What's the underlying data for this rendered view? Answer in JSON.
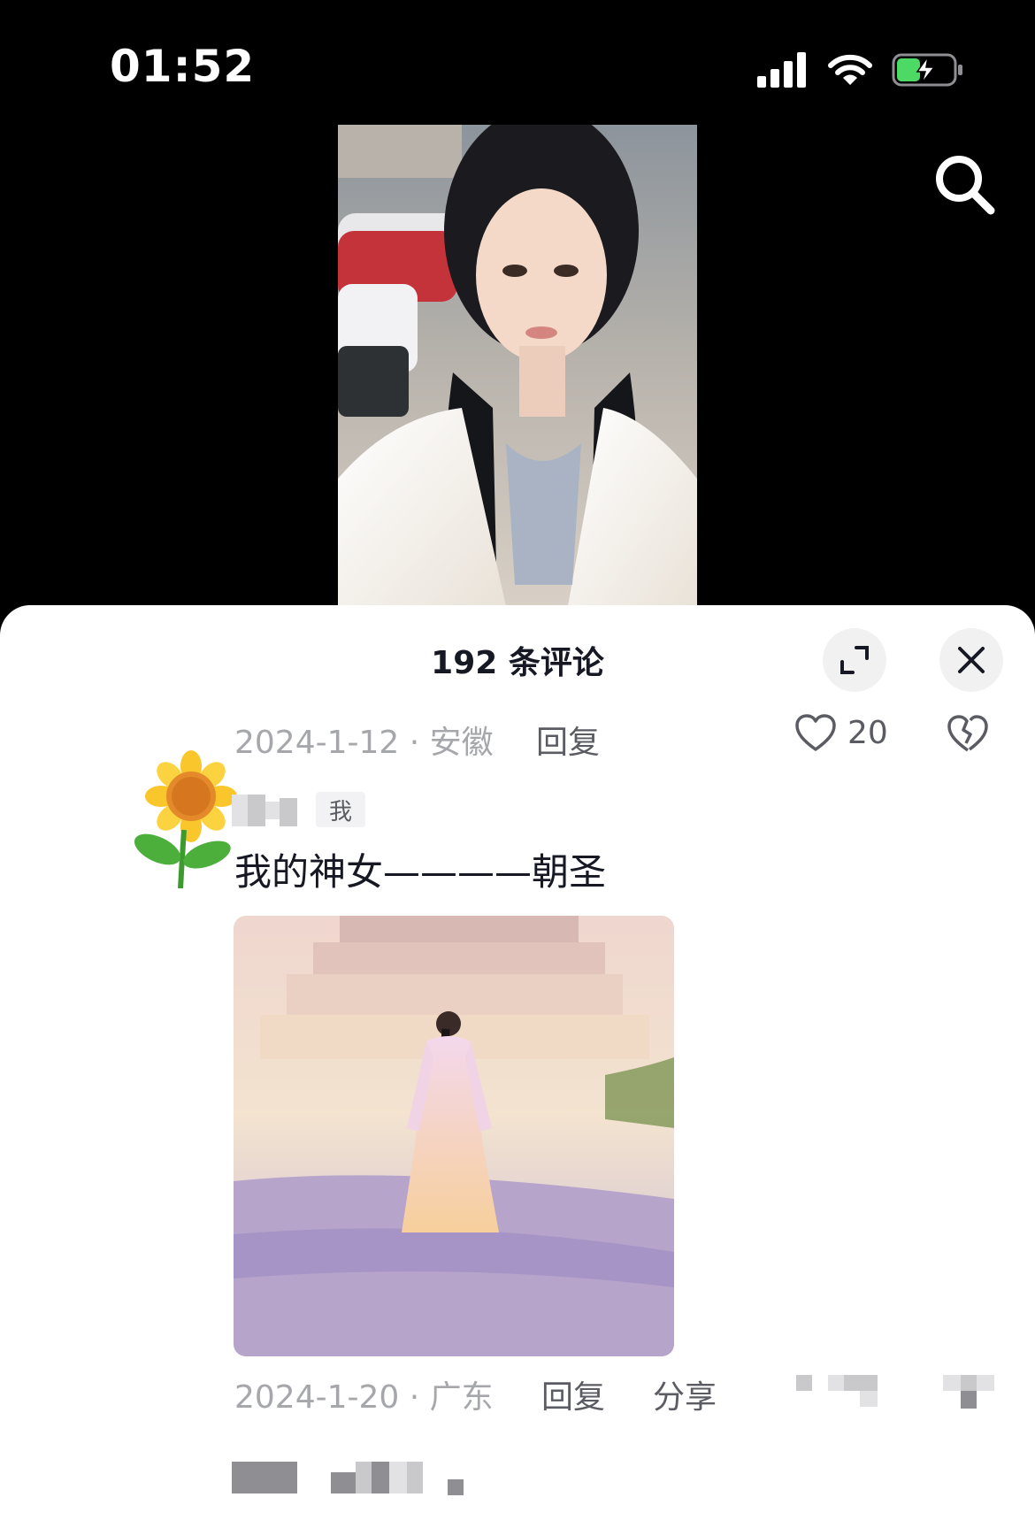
{
  "status_bar": {
    "time": "01:52",
    "battery_charging": true
  },
  "colors": {
    "sheet_bg": "#ffffff",
    "background": "#000000",
    "battery_green": "#4cd964",
    "secondary_text": "#a6a7ab"
  },
  "icons": {
    "search": "search-icon",
    "expand": "expand-icon",
    "close": "close-icon",
    "like": "heart-outline-icon",
    "dislike": "broken-heart-icon",
    "avatar": "sunflower-sticker"
  },
  "sheet": {
    "title": "192 条评论"
  },
  "prev_comment": {
    "date_location": "2024-1-12 · 安徽",
    "reply_label": "回复",
    "like_count": "20"
  },
  "comment": {
    "tag": "我",
    "text": "我的神女————朝圣",
    "date_location": "2024-1-20 · 广东",
    "reply_label": "回复",
    "share_label": "分享"
  }
}
